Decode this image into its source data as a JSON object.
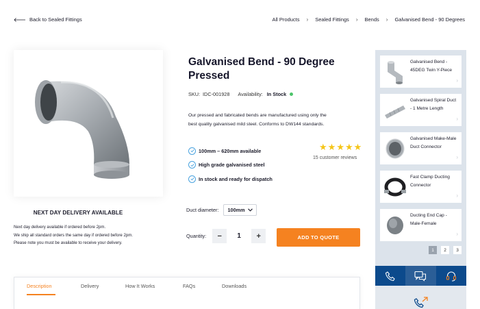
{
  "nav": {
    "back_label": "Back to Sealed Fittings",
    "breadcrumbs": [
      "All Products",
      "Sealed Fittings",
      "Bends",
      "Galvanised Bend - 90 Degrees"
    ]
  },
  "product": {
    "title": "Galvanised Bend - 90 Degree Pressed",
    "sku_label": "SKU:",
    "sku": "IDC-001928",
    "availability_label": "Availability:",
    "availability": "In Stock",
    "description": "Our pressed and fabricated bends are manufactured using only the best quality galvanised mild steel. Conforms to DW144 standards.",
    "features": [
      "100mm – 620mm available",
      "High grade galvanised steel",
      "In stock and ready for dispatch"
    ],
    "rating": 5,
    "reviews": "15 customer reviews"
  },
  "delivery": {
    "title": "NEXT DAY DELIVERY AVAILABLE",
    "lines": [
      "Next day delivery available if ordered before 2pm.",
      "We ship all standard orders the same day if ordered before 2pm.",
      "Please note you must be available to receive your delivery."
    ]
  },
  "options": {
    "duct_label": "Duct diameter:",
    "duct_value": "100mm",
    "quantity_label": "Quantity:",
    "quantity": "1",
    "minus": "−",
    "plus": "+",
    "add_button": "ADD TO QUOTE"
  },
  "tabs": [
    "Description",
    "Delivery",
    "How It Works",
    "FAQs",
    "Downloads"
  ],
  "related": [
    {
      "name": "Galvanised Bend - 45DEG Twin Y-Piece",
      "icon": "y-piece-icon"
    },
    {
      "name": "Galvanised Spiral Duct - 1 Metre Length",
      "icon": "spiral-duct-icon"
    },
    {
      "name": "Galvanised Make-Male Duct Connector",
      "icon": "connector-icon"
    },
    {
      "name": "Fast Clamp Ducting Connector",
      "icon": "clamp-icon"
    },
    {
      "name": "Ducting End Cap - Male-Female",
      "icon": "end-cap-icon"
    }
  ],
  "pagination": [
    "1",
    "2",
    "3"
  ],
  "colors": {
    "accent": "#f58220",
    "contact_bar": "#0c4a8c",
    "sidebar_bg": "#dce3eb",
    "in_stock": "#4cc46a"
  }
}
